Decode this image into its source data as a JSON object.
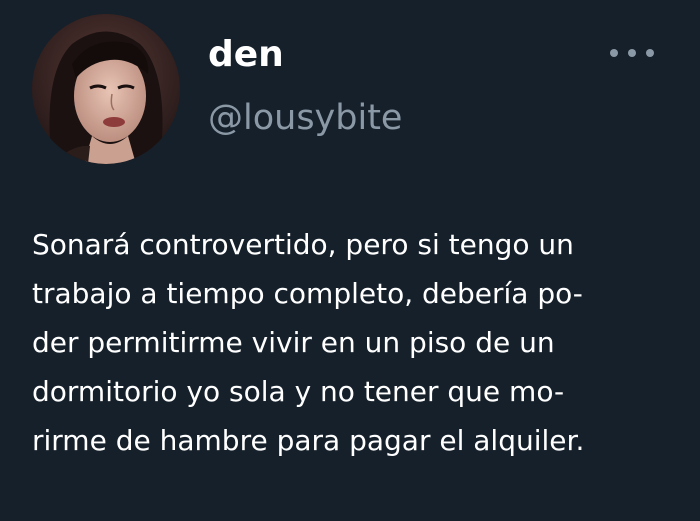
{
  "user": {
    "display_name": "den",
    "handle": "@lousybite"
  },
  "menu": {
    "icon": "more-horizontal-icon"
  },
  "tweet": {
    "lines": [
      "Sonará controvertido, pero si tengo un",
      "trabajo a tiempo completo, debería po-",
      "der permitirme vivir en un piso de un",
      "dormitorio yo sola y no tener que mo-",
      "rirme de hambre para pagar el alquiler."
    ]
  },
  "colors": {
    "background": "#15202b",
    "primary_text": "#ffffff",
    "secondary_text": "#8b98a5"
  }
}
